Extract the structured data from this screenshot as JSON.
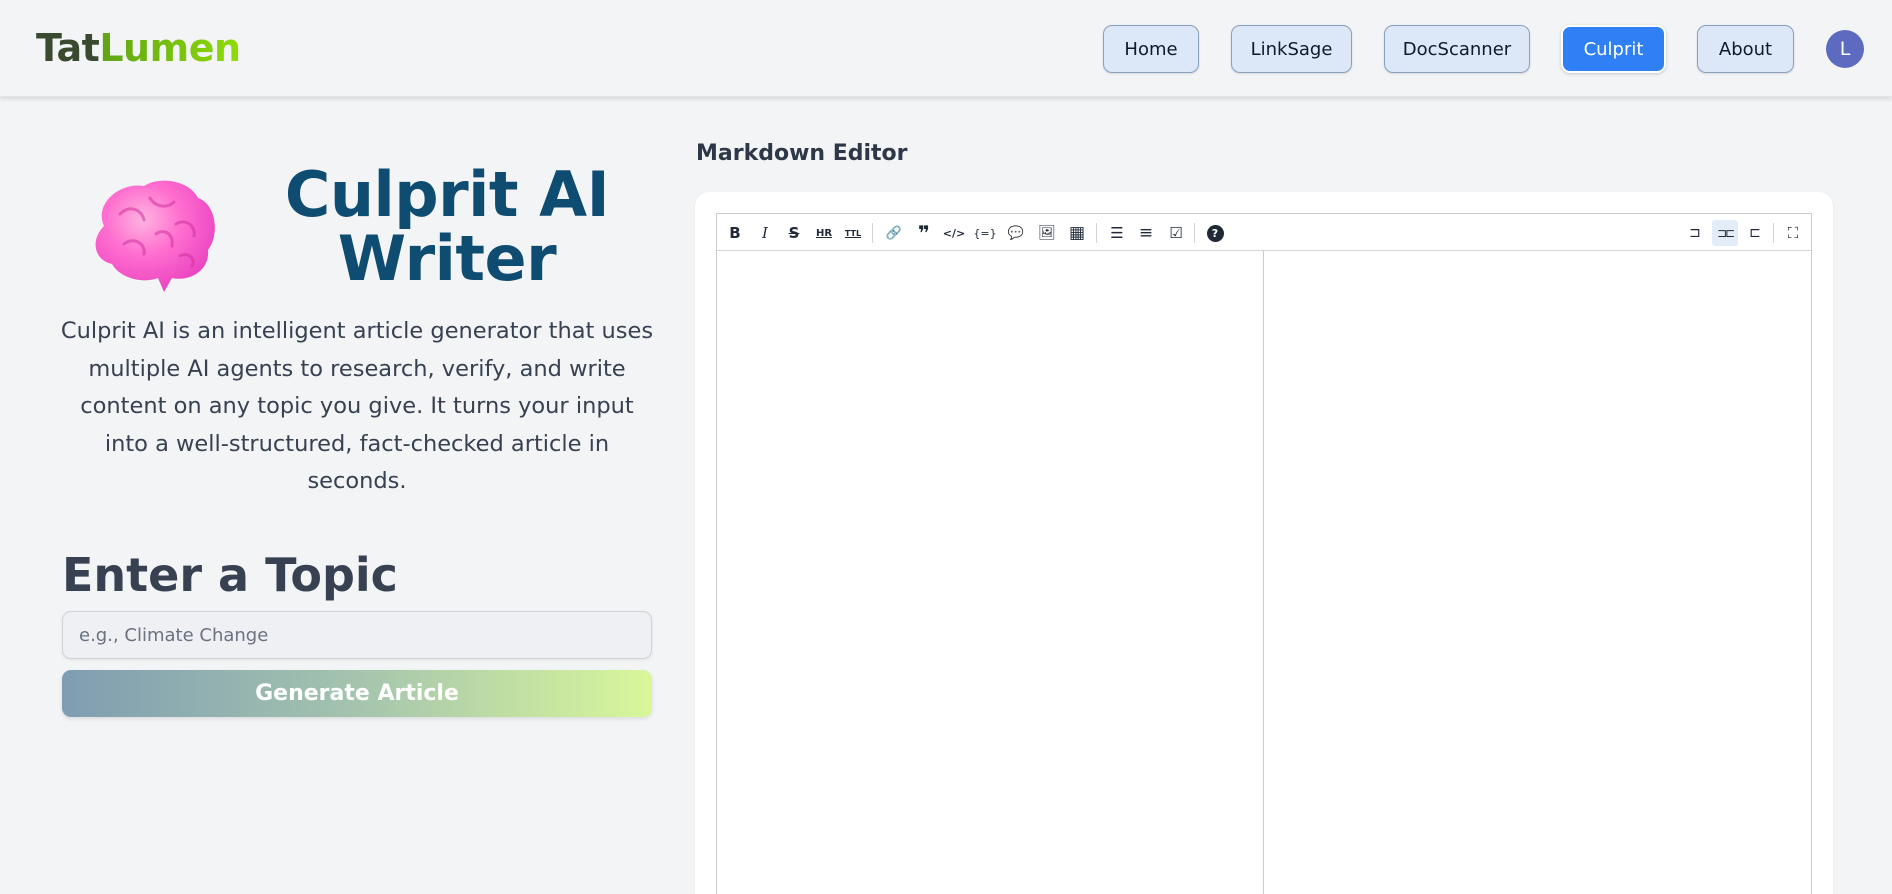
{
  "header": {
    "logo_part1": "Tat",
    "logo_part2": "Lumen",
    "nav": [
      {
        "label": "Home"
      },
      {
        "label": "LinkSage"
      },
      {
        "label": "DocScanner"
      },
      {
        "label": "Culprit",
        "active": true
      },
      {
        "label": "About"
      }
    ],
    "avatar_initial": "L"
  },
  "hero": {
    "icon": "brain-icon",
    "title_line1": "Culprit AI",
    "title_line2": "Writer",
    "description": "Culprit AI is an intelligent article generator that uses multiple AI agents to research, verify, and write content on any topic you give. It turns your input into a well-structured, fact-checked article in seconds."
  },
  "topic": {
    "heading": "Enter a Topic",
    "placeholder": "e.g., Climate Change",
    "value": "",
    "generate_label": "Generate Article"
  },
  "editor": {
    "label": "Markdown Editor",
    "toolbar": [
      {
        "name": "bold-icon",
        "glyph": "B"
      },
      {
        "name": "italic-icon",
        "glyph": "I"
      },
      {
        "name": "strikethrough-icon",
        "glyph": "S"
      },
      {
        "name": "horizontal-rule-icon",
        "glyph": "HR"
      },
      {
        "name": "title-icon",
        "glyph": "TTL"
      },
      {
        "name": "link-icon",
        "glyph": "🔗"
      },
      {
        "name": "quote-icon",
        "glyph": "❞"
      },
      {
        "name": "code-icon",
        "glyph": "</>"
      },
      {
        "name": "code-block-icon",
        "glyph": "{=}"
      },
      {
        "name": "comment-icon",
        "glyph": "💬"
      },
      {
        "name": "image-icon",
        "glyph": "🖼"
      },
      {
        "name": "table-icon",
        "glyph": "▦"
      },
      {
        "name": "unordered-list-icon",
        "glyph": "☰"
      },
      {
        "name": "ordered-list-icon",
        "glyph": "≡"
      },
      {
        "name": "checked-list-icon",
        "glyph": "☑"
      },
      {
        "name": "help-icon",
        "glyph": "?"
      },
      {
        "name": "edit-mode-icon",
        "glyph": "⊐"
      },
      {
        "name": "live-mode-icon",
        "glyph": "⊐⊏"
      },
      {
        "name": "preview-mode-icon",
        "glyph": "⊏"
      },
      {
        "name": "fullscreen-icon",
        "glyph": "⛶"
      }
    ],
    "editor_content": "",
    "preview_content": ""
  },
  "colors": {
    "brand_dark": "#3a4a30",
    "brand_green": "#7ac70c",
    "title_blue": "#0f4c71",
    "active_nav": "#2f80f4",
    "nav_bg": "#dce8f8"
  }
}
